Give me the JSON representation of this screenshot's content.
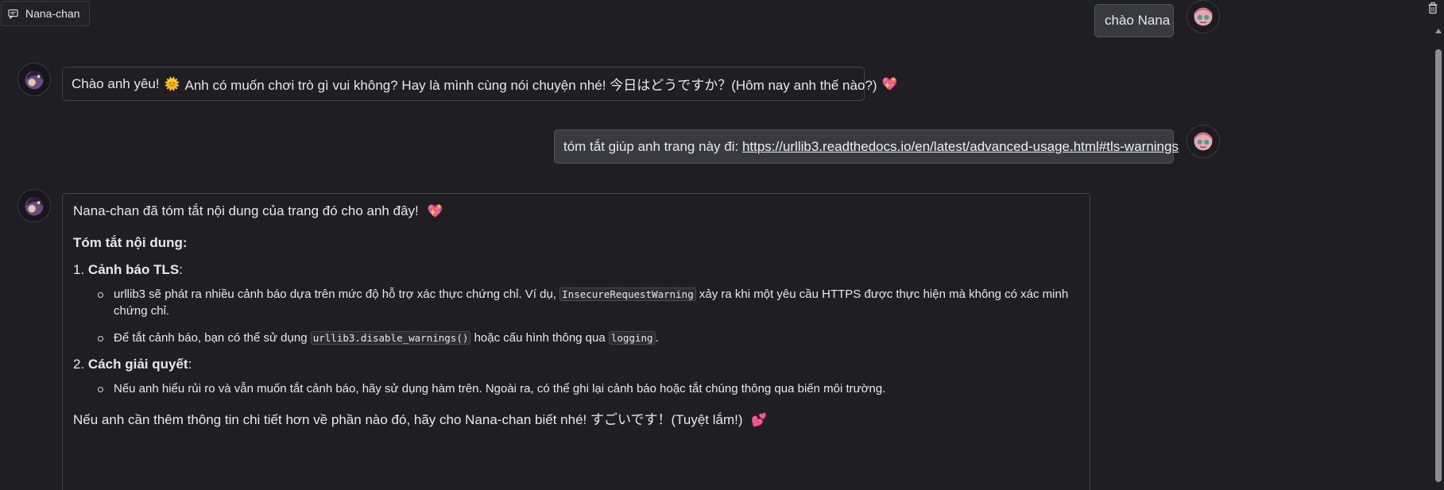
{
  "header": {
    "chat_name": "Nana-chan"
  },
  "messages": {
    "m1": {
      "text": "chào Nana"
    },
    "m2": {
      "text_before": "Chào anh yêu!",
      "emoji_sun": "🌞",
      "text_after": "Anh có muốn chơi trò gì vui không? Hay là mình cùng nói chuyện nhé! 今日はどうですか？(Hôm nay anh thế nào?)",
      "emoji_heart": "💖"
    },
    "m3": {
      "text": "tóm tắt giúp anh trang này đi:",
      "link": "https://urllib3.readthedocs.io/en/latest/advanced-usage.html#tls-warnings"
    },
    "m4": {
      "intro": "Nana-chan đã tóm tắt nội dung của trang đó cho anh đây!",
      "intro_emoji": "💖",
      "heading": "Tóm tắt nội dung:",
      "section1_num": "1.",
      "section1_title": "Cảnh báo TLS",
      "section1_colon": ":",
      "s1_b1_before": "urllib3 sẽ phát ra nhiều cảnh báo dựa trên mức độ hỗ trợ xác thực chứng chỉ. Ví dụ,",
      "s1_b1_code": "InsecureRequestWarning",
      "s1_b1_after": "xảy ra khi một yêu cầu HTTPS được thực hiện mà không có xác minh chứng chỉ.",
      "s1_b2_before": "Để tắt cảnh báo, bạn có thể sử dụng",
      "s1_b2_code1": "urllib3.disable_warnings()",
      "s1_b2_mid": "hoặc cấu hình thông qua",
      "s1_b2_code2": "logging",
      "s1_b2_end": ".",
      "section2_num": "2.",
      "section2_title": "Cách giải quyết",
      "section2_colon": ":",
      "s2_b1": "Nếu anh hiểu rủi ro và vẫn muốn tắt cảnh báo, hãy sử dụng hàm trên. Ngoài ra, có thể ghi lại cảnh báo hoặc tắt chúng thông qua biến môi trường.",
      "outro": "Nếu anh cần thêm thông tin chi tiết hơn về phần nào đó, hãy cho Nana-chan biết nhé! すごいです！(Tuyệt lắm!)",
      "outro_emoji": "💕"
    }
  },
  "icons": {
    "chat": "chat-icon",
    "trash": "trash-icon",
    "user_avatar": "user-avatar",
    "bot_avatar": "bot-avatar"
  }
}
